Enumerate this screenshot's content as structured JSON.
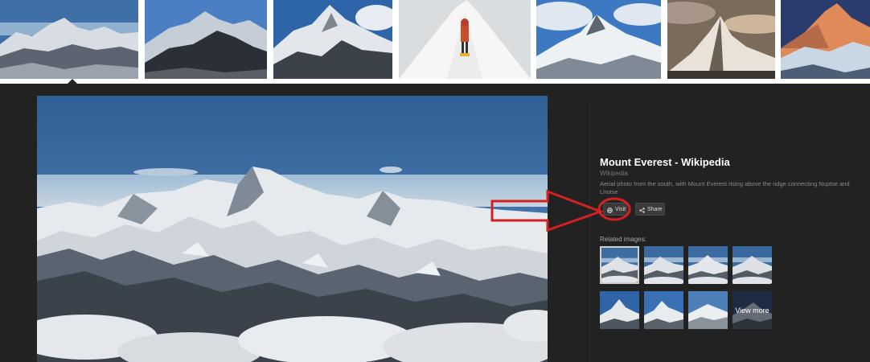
{
  "result_thumbnails": [
    {
      "name": "thumb-everest-south-aerial",
      "sky": "#3f6fa6",
      "tone": "#d8dde3"
    },
    {
      "name": "thumb-everest-dark-ridge",
      "sky": "#4a7fc4",
      "tone": "#b9c3cf"
    },
    {
      "name": "thumb-everest-rocky-face",
      "sky": "#2e64a8",
      "tone": "#e3e6ea"
    },
    {
      "name": "thumb-climber-summit-ridge",
      "sky": "#d9dde0",
      "tone": "#f4f4f4"
    },
    {
      "name": "thumb-everest-blue-sky",
      "sky": "#3d78c3",
      "tone": "#eef1f4"
    },
    {
      "name": "thumb-everest-sunset-clouds",
      "sky": "#7a6b5a",
      "tone": "#e9e2d8"
    },
    {
      "name": "thumb-everest-alpenglow",
      "sky": "#2a3c6e",
      "tone": "#e08a5a"
    }
  ],
  "detail": {
    "title": "Mount Everest - Wikipedia",
    "source": "Wikipedia",
    "description": "Aerial photo from the south, with Mount Everest rising above the ridge connecting Nuptse and Lhotse",
    "visit_label": "Visit",
    "share_label": "Share",
    "visit_icon": "globe-icon",
    "share_icon": "share-icon",
    "related_label": "Related images:",
    "view_more_label": "View more",
    "related_count": 8
  },
  "annotation": {
    "color": "#d32020",
    "arrow_target": "visit-button",
    "circle_target": "visit-button"
  },
  "colors": {
    "page_background": "#222222",
    "strip_background": "#ffffff",
    "title_text": "#ffffff",
    "muted_text": "#8a8a8a",
    "button_background": "#3a3a3a"
  }
}
